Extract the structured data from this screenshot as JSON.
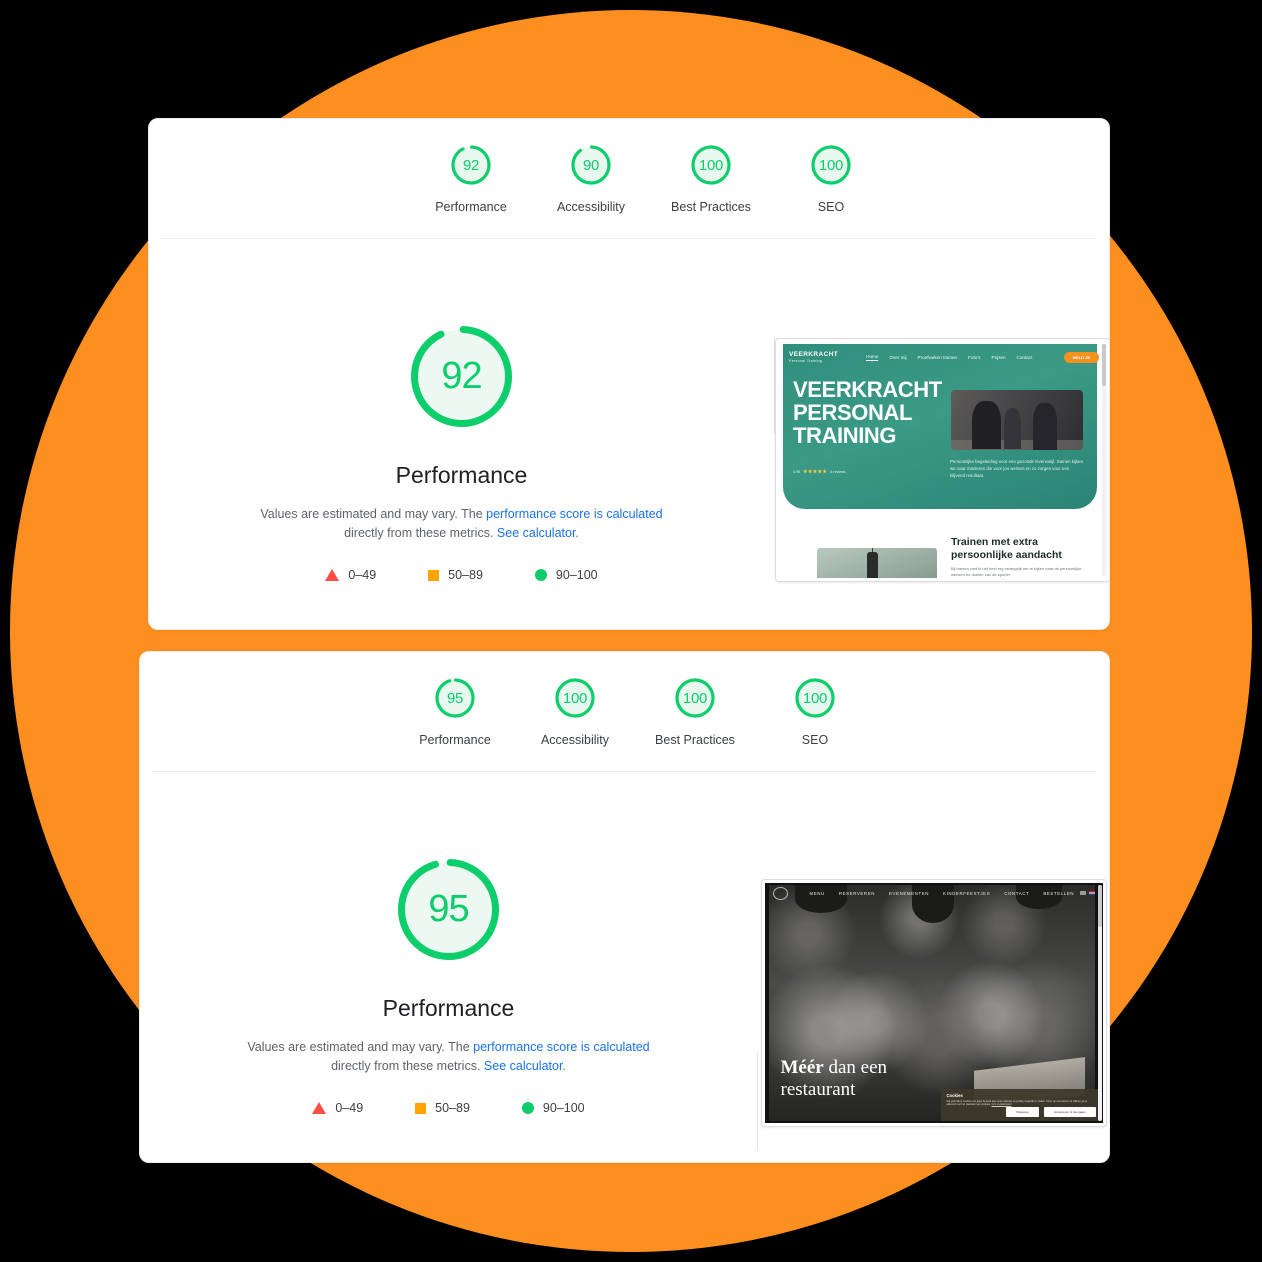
{
  "theme": {
    "background": "#000000",
    "accent_circle": "#FD8F20",
    "score_green": "#0CCE6B",
    "score_orange": "#FFA400",
    "score_red": "#FF4E42",
    "link_blue": "#1a73e8"
  },
  "reports": [
    {
      "id": "report-veerkracht",
      "category_scores": [
        {
          "value": "92",
          "label": "Performance"
        },
        {
          "value": "90",
          "label": "Accessibility"
        },
        {
          "value": "100",
          "label": "Best Practices"
        },
        {
          "value": "100",
          "label": "SEO"
        }
      ],
      "detail": {
        "score": "92",
        "title": "Performance",
        "disclaimer_pre": "Values are estimated and may vary. The ",
        "disclaimer_link1": "performance score is calculated",
        "disclaimer_mid": " directly from these metrics. ",
        "disclaimer_link2": "See calculator."
      },
      "legend": [
        {
          "icon": "triangle-icon",
          "range": "0–49"
        },
        {
          "icon": "square-icon",
          "range": "50–89"
        },
        {
          "icon": "circle-icon",
          "range": "90–100"
        }
      ],
      "screenshot": {
        "type": "veerkracht",
        "logo_line1": "VEERKRACHT",
        "logo_line2": "Personal Training",
        "nav": [
          "Home",
          "Over mij",
          "Proefweken trainen",
          "Foto's",
          "Prijzen",
          "Contact"
        ],
        "cta": "MELD JE",
        "heading_lines": [
          "VEERKRACHT",
          "PERSONAL",
          "TRAINING"
        ],
        "rating_value": "4.95",
        "rating_stars": "★★★★★",
        "rating_count": "6 reviews",
        "hero_paragraph": "Persoonlijke begeleiding voor een gezonde levensstijl. Samen kijken we naar manieren die voor jou werken en zo zorgen voor een blijvend resultaat.",
        "section_heading": "Trainen met extra persoonlijke aandacht",
        "section_paragraph": "Bij trainen vind ik het heel erg belangrijk om te kijken naar de persoonlijke wensen en doelen van de sporter."
      }
    },
    {
      "id": "report-restaurant",
      "category_scores": [
        {
          "value": "95",
          "label": "Performance"
        },
        {
          "value": "100",
          "label": "Accessibility"
        },
        {
          "value": "100",
          "label": "Best Practices"
        },
        {
          "value": "100",
          "label": "SEO"
        }
      ],
      "detail": {
        "score": "95",
        "title": "Performance",
        "disclaimer_pre": "Values are estimated and may vary. The ",
        "disclaimer_link1": "performance score is calculated",
        "disclaimer_mid": " directly from these metrics. ",
        "disclaimer_link2": "See calculator."
      },
      "legend": [
        {
          "icon": "triangle-icon",
          "range": "0–49"
        },
        {
          "icon": "square-icon",
          "range": "50–89"
        },
        {
          "icon": "circle-icon",
          "range": "90–100"
        }
      ],
      "screenshot": {
        "type": "restaurant",
        "nav": [
          "MENU",
          "RESERVEREN",
          "EVENEMENTEN",
          "KINDERFEESTJES",
          "CONTACT",
          "BESTELLEN"
        ],
        "heading_bold": "Méér",
        "heading_rest": " dan een",
        "heading_line2": "restaurant",
        "cookie_title": "Cookies",
        "cookie_body": "Wij gebruiken cookies om jouw bezoek aan onze website zo prettig mogelijk te maken. Door op accepteren te klikken ga je akkoord met het plaatsen van cookies.",
        "cookie_link": "Ons cookiebeleid",
        "cookie_decline": "Weigeren",
        "cookie_accept": "Accepteren & doorgaan"
      }
    }
  ]
}
